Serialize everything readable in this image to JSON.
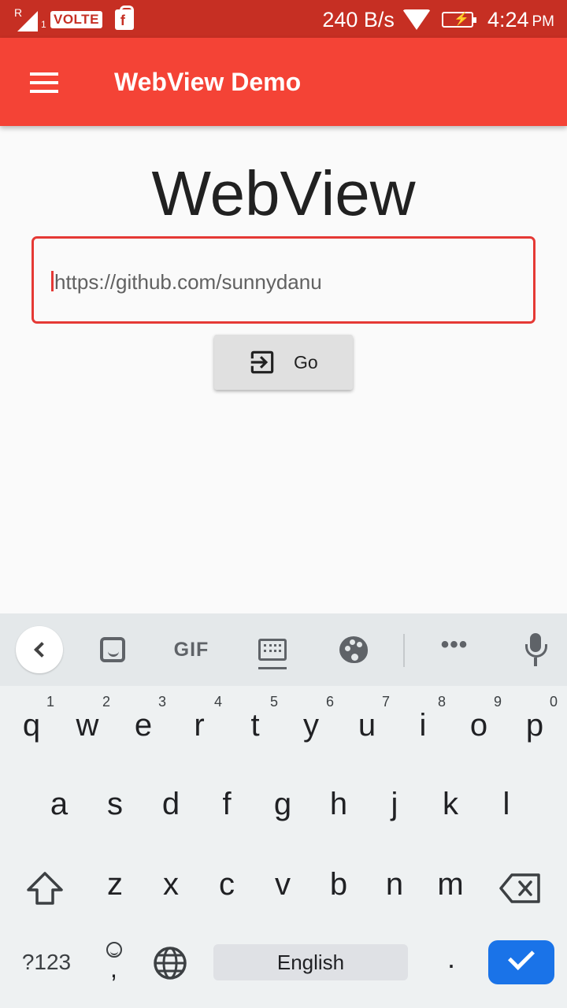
{
  "status_bar": {
    "roaming": "R",
    "sim": "1",
    "volte": "VOLTE",
    "bag_letter": "f",
    "net_speed": "240 B/s",
    "time": "4:24",
    "ampm": "PM"
  },
  "app_bar": {
    "title": "WebView Demo",
    "menu_icon": "hamburger-menu-icon"
  },
  "main": {
    "heading": "WebView",
    "url_value": "https://github.com/sunnydanu",
    "go_label": "Go",
    "go_icon": "exit-to-app-icon"
  },
  "keyboard": {
    "toolbar_gif": "GIF",
    "toolbar_more": "•••",
    "row1": [
      {
        "ch": "q",
        "hint": "1"
      },
      {
        "ch": "w",
        "hint": "2"
      },
      {
        "ch": "e",
        "hint": "3"
      },
      {
        "ch": "r",
        "hint": "4"
      },
      {
        "ch": "t",
        "hint": "5"
      },
      {
        "ch": "y",
        "hint": "6"
      },
      {
        "ch": "u",
        "hint": "7"
      },
      {
        "ch": "i",
        "hint": "8"
      },
      {
        "ch": "o",
        "hint": "9"
      },
      {
        "ch": "p",
        "hint": "0"
      }
    ],
    "row2": [
      "a",
      "s",
      "d",
      "f",
      "g",
      "h",
      "j",
      "k",
      "l"
    ],
    "row3": [
      "z",
      "x",
      "c",
      "v",
      "b",
      "n",
      "m"
    ],
    "symbols_label": "?123",
    "emoji_comma": ",",
    "space_label": "English",
    "period": ".",
    "enter_color": "#1a73e8"
  },
  "colors": {
    "status_bar": "#c62f23",
    "app_bar": "#f44336",
    "accent": "#e53935"
  }
}
